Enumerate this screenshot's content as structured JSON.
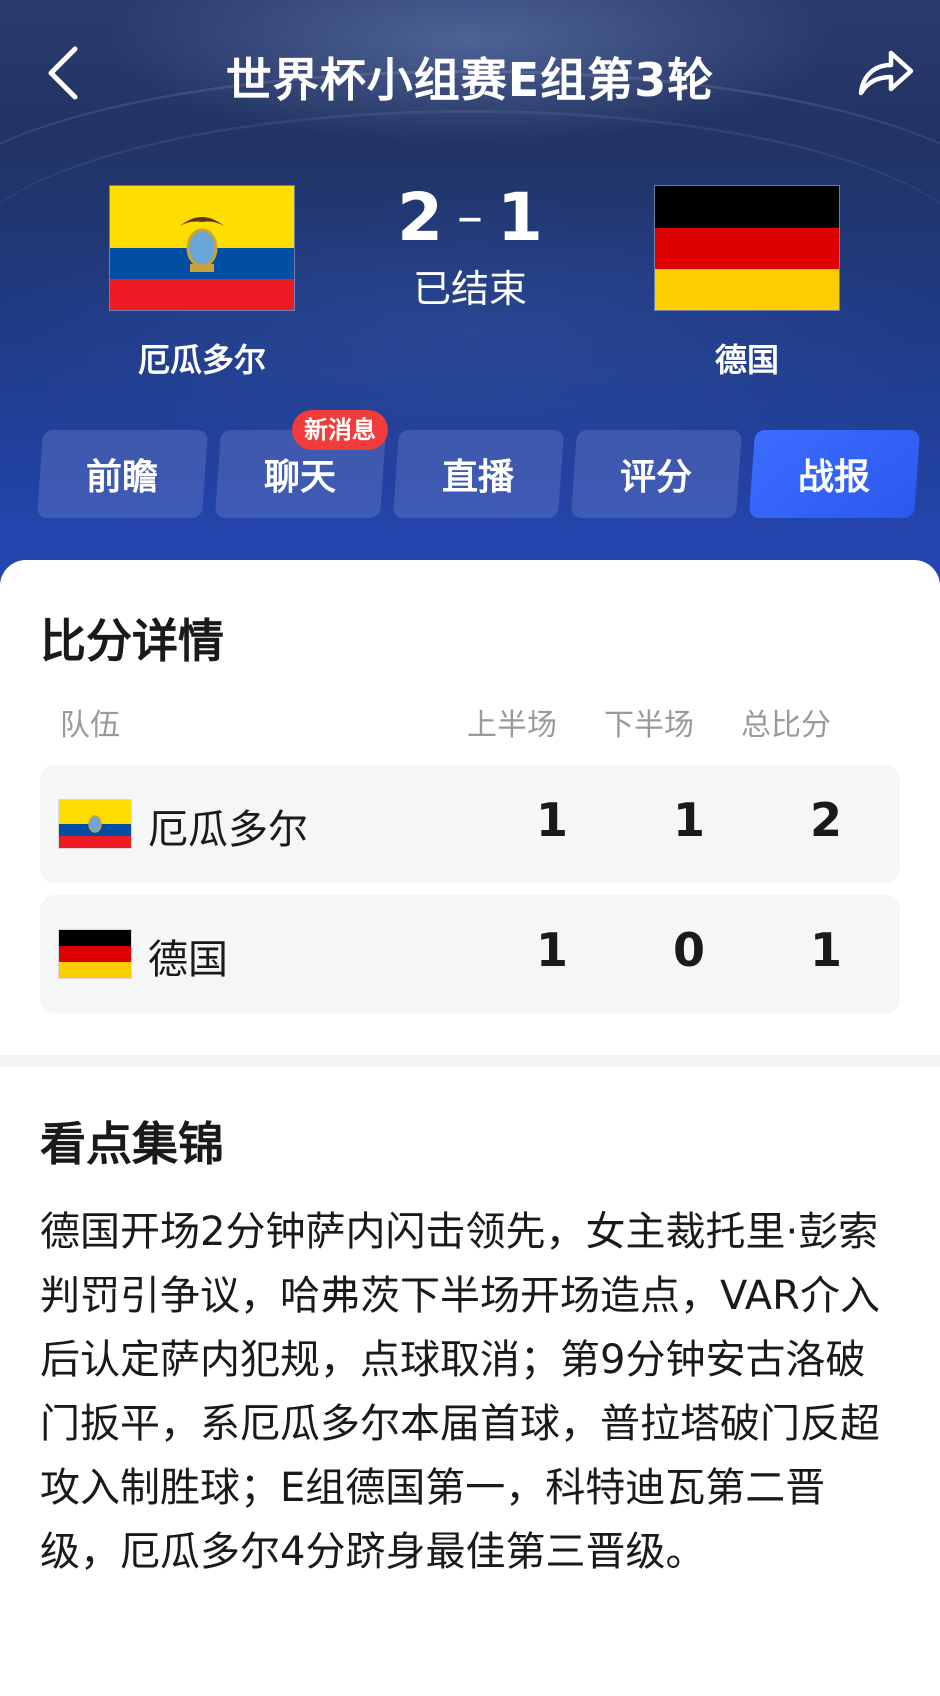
{
  "header": {
    "title": "世界杯小组赛E组第3轮",
    "home_team": "厄瓜多尔",
    "away_team": "德国",
    "home_score": "2",
    "away_score": "1",
    "separator": "–",
    "status": "已结束"
  },
  "tabs": [
    {
      "label": "前瞻"
    },
    {
      "label": "聊天"
    },
    {
      "label": "直播"
    },
    {
      "label": "评分"
    },
    {
      "label": "战报"
    }
  ],
  "active_tab": "战报",
  "chat_badge": "新消息",
  "score_detail": {
    "title": "比分详情",
    "columns": [
      "队伍",
      "上半场",
      "下半场",
      "总比分"
    ],
    "rows": [
      {
        "team": "厄瓜多尔",
        "first_half": "1",
        "second_half": "1",
        "total": "2"
      },
      {
        "team": "德国",
        "first_half": "1",
        "second_half": "0",
        "total": "1"
      }
    ]
  },
  "highlights": {
    "title": "看点集锦",
    "text": "德国开场2分钟萨内闪击领先，女主裁托里·彭索判罚引争议，哈弗茨下半场开场造点，VAR介入后认定萨内犯规，点球取消；第9分钟安古洛破门扳平，系厄瓜多尔本届首球，普拉塔破门反超攻入制胜球；E组德国第一，科特迪瓦第二晋级，厄瓜多尔4分跻身最佳第三晋级。"
  },
  "colors": {
    "header_top": "#2a3b6c",
    "header_bottom": "#2548b8",
    "active_tab": "#3c6dff",
    "badge": "#f23b3b",
    "row_bg": "#f5f6f8"
  },
  "icons": [
    "back-arrow-icon",
    "share-icon",
    "ecuador-flag-icon",
    "germany-flag-icon"
  ]
}
